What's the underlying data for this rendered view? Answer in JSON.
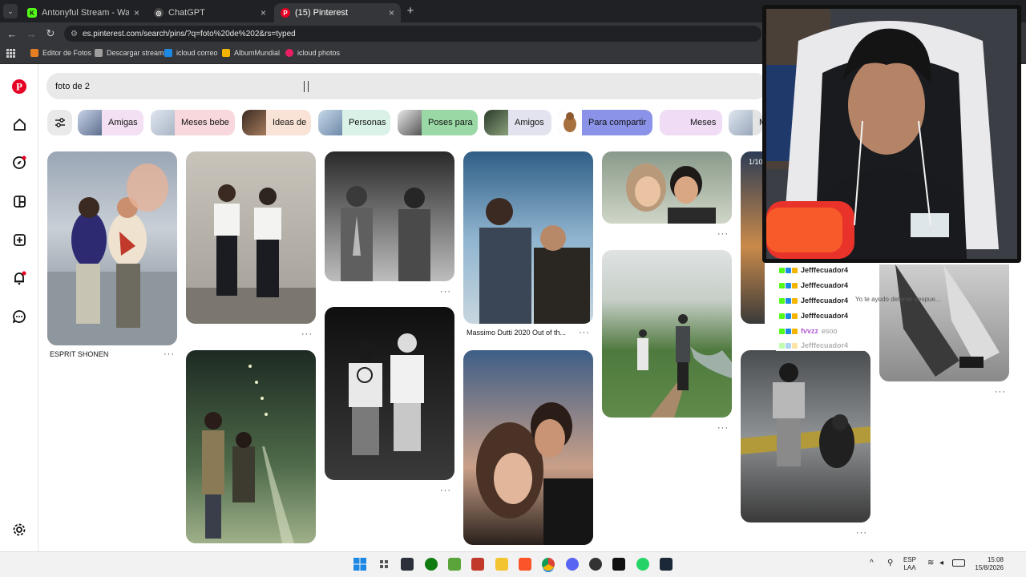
{
  "browser": {
    "tabs": [
      {
        "title": "Antonyful Stream - Watch Live",
        "icon": "kick-icon",
        "color": "#53fc18",
        "active": false
      },
      {
        "title": "ChatGPT",
        "icon": "chatgpt-icon",
        "color": "#e8e8e8",
        "active": false
      },
      {
        "title": "(15) Pinterest",
        "icon": "pinterest-icon",
        "color": "#e60023",
        "active": true
      }
    ],
    "url": "es.pinterest.com/search/pins/?q=foto%20de%202&rs=typed",
    "bookmarks": [
      {
        "label": "Editor de Fotos",
        "color": "#e67e22"
      },
      {
        "label": "Descargar stream",
        "color": "#9e9e9e"
      },
      {
        "label": "icloud correo",
        "color": "#1e88e5"
      },
      {
        "label": "AlbumMundial",
        "color": "#f4b400"
      },
      {
        "label": "icloud photos",
        "color": "#e91e63"
      }
    ]
  },
  "pinterest": {
    "search_value": "foto de 2",
    "chips": [
      "Amigas",
      "Meses bebe",
      "Ideas de",
      "Personas",
      "Poses para",
      "Amigos",
      "Para compartir",
      "Meses",
      "M"
    ],
    "chip_colors": [
      "#f3e0f3",
      "#f8d8dc",
      "#f9e2d6",
      "#d9f1e6",
      "#9ad9a5",
      "#e3e3ef",
      "#8b93e8",
      "#f0dcf5",
      "#e4e4e4"
    ],
    "pins": [
      {
        "title": "ESPRIT SHONEN"
      },
      {
        "title": ""
      },
      {
        "title": ""
      },
      {
        "title": "Massimo Dutti 2020 Out of th..."
      },
      {
        "title": ""
      },
      {
        "title": ""
      }
    ],
    "carousel_counter": "1/10"
  },
  "stream_overlay": {
    "chat": [
      {
        "user": "Jefffecuador4",
        "message": ""
      },
      {
        "user": "Jefffecuador4",
        "message": ""
      },
      {
        "user": "Jefffecuador4",
        "message": "Yo te ayudo detonar despue..."
      },
      {
        "user": "Jefffecuador4",
        "message": ""
      },
      {
        "user": "fvvzz",
        "message": "esoo"
      },
      {
        "user": "Jefffecuador4",
        "message": ""
      }
    ]
  },
  "taskbar": {
    "lang_top": "ESP",
    "lang_bottom": "LAA",
    "time": "15:08",
    "date": "15/8/2026"
  }
}
